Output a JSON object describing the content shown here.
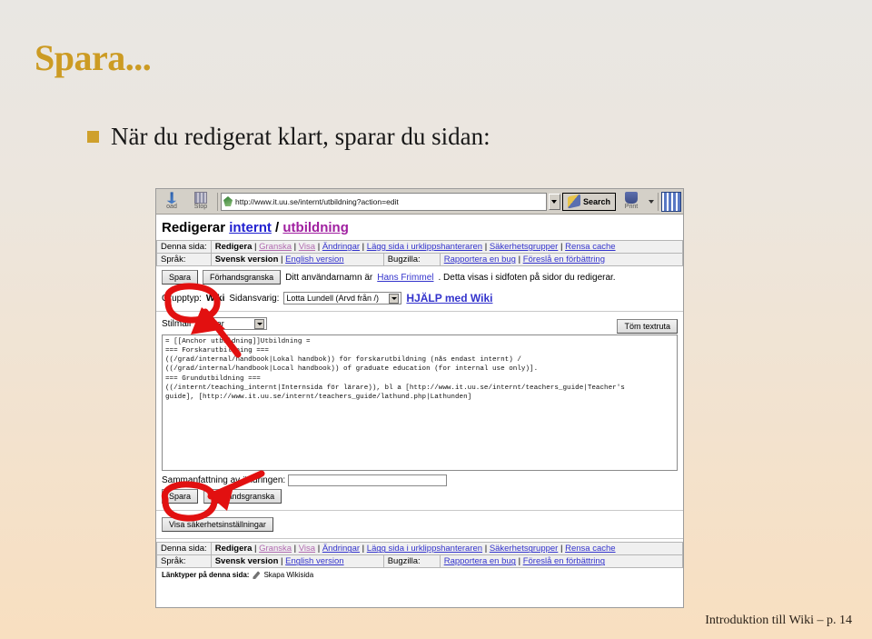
{
  "slide": {
    "title": "Spara...",
    "bullet": "När du redigerat klart, sparar du sidan:",
    "footer": "Introduktion till Wiki – p. 14",
    "accent_color": "#cc9b23",
    "bullet_marker_color": "#cfa02c"
  },
  "browser": {
    "reload_label": "oad",
    "stop_label": "Stop",
    "url": "http://www.it.uu.se/internt/utbildning?action=edit",
    "search_label": "Search",
    "print_label": "Print"
  },
  "page": {
    "heading_prefix": "Redigerar ",
    "heading_link1": "internt",
    "heading_sep": " / ",
    "heading_link2": "utbildning",
    "nav": {
      "denna_sida_label": "Denna sida:",
      "denna_sida_current": "Redigera",
      "denna_sida_links": [
        "Granska",
        "Visa",
        "Ändringar",
        "Lägg sida i urklippshanteraren",
        "Säkerhetsgrupper",
        "Rensa cache"
      ],
      "sprak_label": "Språk:",
      "sprak_current": "Svensk version",
      "sprak_other": "English version",
      "bugzilla_label": "Bugzilla:",
      "bugzilla_links": [
        "Rapportera en bug",
        "Föreslå en förbättring"
      ]
    },
    "toolbar_row": {
      "save_button": "Spara",
      "preview_button": "Förhandsgranska",
      "username_prefix": "Ditt användarnamn är ",
      "username": "Hans Frimmel",
      "username_suffix": ". Detta visas i sidfoten på sidor du redigerar."
    },
    "owner_row": {
      "grouptype_label": "Grupptyp:",
      "grouptype_value": "Wiki",
      "sidansvarig_label": "Sidansvarig:",
      "sidansvarig_value": "Lotta Lundell (Arvd från /)",
      "help_link": "HJÄLP med Wiki"
    },
    "stilmall": {
      "label": "Stilmall",
      "value": "tabular",
      "clear_button": "Töm textruta"
    },
    "textarea_content": "= [[Anchor utbildning]]Utbildning =\n=== Forskarutbildning ===\n((/grad/internal/handbook|Lokal handbok)) för forskarutbildning (nås endast internt) /\n((/grad/internal/handbook|Local handbook)) of graduate education (for internal use only)].\n=== Grundutbildning ===\n((/internt/teaching_internt|Internsida för lärare)), bl a [http://www.it.uu.se/internt/teachers_guide|Teacher's\nguide], [http://www.it.uu.se/internt/teachers_guide/lathund.php|Lathunden]",
    "summary": {
      "label": "Sammanfattning av ändringen:",
      "value": "",
      "save_button": "Spara",
      "preview_button": "Förhandsgranska"
    },
    "security_button": "Visa säkerhetsinställningar",
    "link_types": {
      "label": "Länktyper på denna sida:",
      "value": "Skapa Wikisida"
    }
  },
  "annotations": {
    "color": "#e01010",
    "note": "two red hand-drawn ellipses highlighting the Spara buttons with arrows"
  }
}
